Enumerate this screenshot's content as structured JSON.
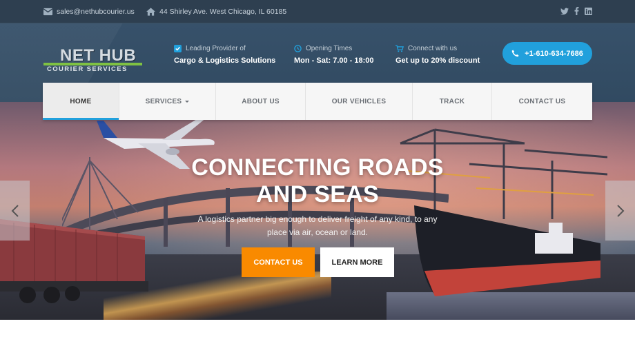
{
  "topbar": {
    "email": "sales@nethubcourier.us",
    "address": "44 Shirley Ave. West Chicago, IL 60185",
    "icons": [
      "envelope-icon",
      "home-icon",
      "twitter-icon",
      "facebook-icon",
      "linkedin-icon"
    ]
  },
  "logo": {
    "main": "NET HUB",
    "sub": "COURIER SERVICES"
  },
  "header": {
    "info": [
      {
        "icon": "checkbox-icon",
        "line1": "Leading Provider of",
        "line2": "Cargo & Logistics Solutions"
      },
      {
        "icon": "clock-icon",
        "line1": "Opening Times",
        "line2": "Mon - Sat: 7.00 - 18:00"
      },
      {
        "icon": "cart-icon",
        "line1": "Connect with us",
        "line2": "Get up to 20% discount"
      }
    ],
    "phone": "+1-610-634-7686"
  },
  "nav": {
    "items": [
      {
        "label": "HOME",
        "active": true
      },
      {
        "label": "SERVICES",
        "dropdown": true
      },
      {
        "label": "ABOUT US"
      },
      {
        "label": "OUR VEHICLES"
      },
      {
        "label": "TRACK"
      },
      {
        "label": "CONTACT US"
      }
    ]
  },
  "hero": {
    "title_line1": "CONNECTING ROADS",
    "title_line2": "AND SEAS",
    "subtitle": "A logistics partner big enough to deliver freight of any kind, to any place via air, ocean or land.",
    "contact_button": "CONTACT US",
    "learn_button": "LEARN MORE"
  },
  "colors": {
    "accent_blue": "#21a0dc",
    "accent_orange": "#f98a00",
    "logo_green": "#7fc242",
    "header_bg": "#314a61"
  }
}
